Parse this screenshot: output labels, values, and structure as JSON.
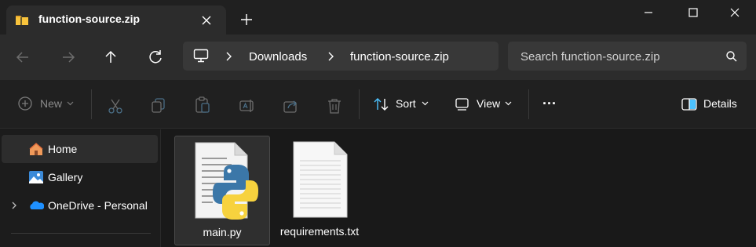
{
  "window": {
    "tab_title": "function-source.zip",
    "new_tab_label": "+"
  },
  "address_bar": {
    "breadcrumbs": [
      "Downloads",
      "function-source.zip"
    ],
    "search_placeholder": "Search function-source.zip"
  },
  "command_bar": {
    "new_label": "New",
    "sort_label": "Sort",
    "view_label": "View",
    "more_label": "...",
    "details_label": "Details"
  },
  "sidebar": {
    "items": [
      {
        "label": "Home",
        "icon": "home-icon",
        "selected": true
      },
      {
        "label": "Gallery",
        "icon": "gallery-icon",
        "selected": false
      },
      {
        "label": "OneDrive - Personal",
        "icon": "onedrive-icon",
        "selected": false,
        "expandable": true
      }
    ]
  },
  "files": [
    {
      "name": "main.py",
      "icon": "python-file-icon",
      "selected": true
    },
    {
      "name": "requirements.txt",
      "icon": "text-file-icon",
      "selected": false
    }
  ],
  "colors": {
    "background": "#191919",
    "titlebar": "#202020",
    "toolbar": "#2c2c2c",
    "accent_blue": "#4cc2ff",
    "folder_yellow": "#f8c33c"
  }
}
